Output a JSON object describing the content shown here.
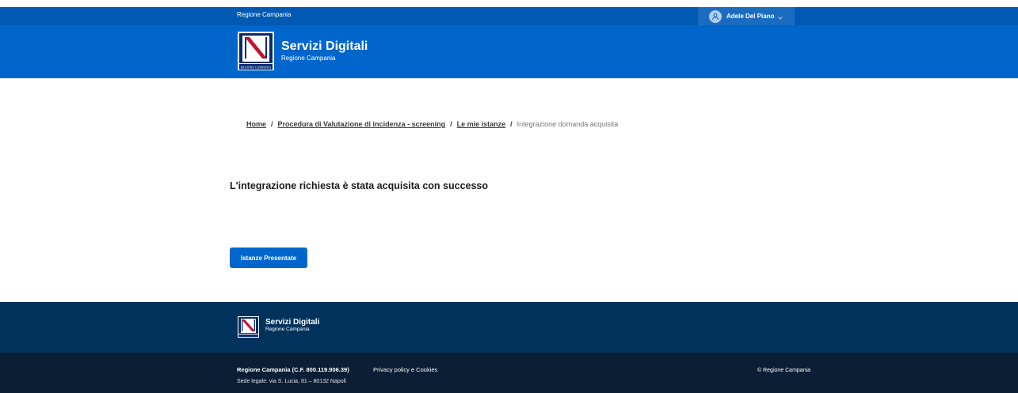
{
  "topbar": {
    "region_link": "Regione Campania",
    "user_name": "Adele Del Piano",
    "user_icon": "user-icon",
    "chevron_icon": "chevron-down-icon"
  },
  "header": {
    "logo_caption": "REGIONE CAMPANIA",
    "title": "Servizi Digitali",
    "subtitle": "Regione Campania"
  },
  "breadcrumb": {
    "items": [
      "Home",
      "Procedura di Valutazione di incidenza - screening",
      "Le mie istanze"
    ],
    "separator": "/",
    "current": "Integrazione domanda acquisita"
  },
  "main": {
    "message": "L'integrazione richiesta è stata acquisita con successo",
    "button_label": "Istanze Presentate"
  },
  "footer": {
    "title": "Servizi Digitali",
    "subtitle": "Regione Campania",
    "entity": "Regione Campania (C.F. 800.119.906.39)",
    "address": "Sede legale: via S. Lucia, 81 – 80132 Napoli",
    "privacy": "Privacy policy e Cookies",
    "copyright": "© Regione Campania"
  },
  "colors": {
    "topbar": "#0059b3",
    "header": "#0066cc",
    "button": "#0066cc",
    "footer_top": "#01325c",
    "footer_bottom": "#0b1e33"
  }
}
